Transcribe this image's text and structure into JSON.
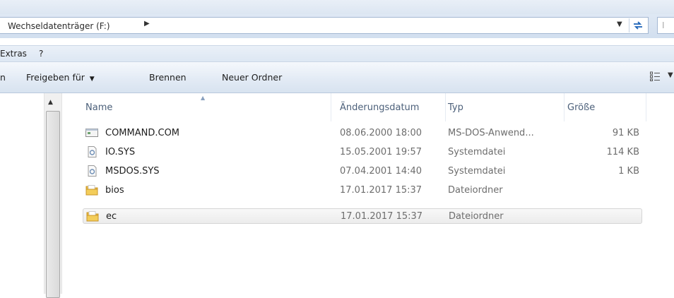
{
  "address_bar": {
    "path": "Wechseldatenträger (F:)",
    "path_arrow_icon": "arrow-right-icon",
    "dropdown_icon": "chevron-down-icon",
    "refresh_icon": "refresh-icon",
    "search_placeholder": "I"
  },
  "menu": {
    "items": [
      "Extras",
      "?"
    ]
  },
  "toolbar": {
    "partial_item": "n",
    "share_label": "Freigeben für",
    "burn_label": "Brennen",
    "new_folder_label": "Neuer Ordner",
    "views_icon": "view-options-icon"
  },
  "columns": {
    "name": "Name",
    "date": "Änderungsdatum",
    "type": "Typ",
    "size": "Größe",
    "sorted_by": "name"
  },
  "files": [
    {
      "name": "COMMAND.COM",
      "date": "08.06.2000 18:00",
      "type": "MS-DOS-Anwend...",
      "size": "91 KB",
      "icon": "application-icon"
    },
    {
      "name": "IO.SYS",
      "date": "15.05.2001 19:57",
      "type": "Systemdatei",
      "size": "114 KB",
      "icon": "system-file-icon"
    },
    {
      "name": "MSDOS.SYS",
      "date": "07.04.2001 14:40",
      "type": "Systemdatei",
      "size": "1 KB",
      "icon": "system-file-icon"
    },
    {
      "name": "bios",
      "date": "17.01.2017 15:37",
      "type": "Dateiordner",
      "size": "",
      "icon": "folder-icon"
    },
    {
      "name": "ec",
      "date": "17.01.2017 15:37",
      "type": "Dateiordner",
      "size": "",
      "icon": "folder-icon",
      "selected": true
    }
  ],
  "colors": {
    "selection_bg": "#ececec",
    "header_text": "#4c607a",
    "folder": "#e8b83a",
    "toolbar_gradient_bottom": "#d8e3f0"
  }
}
